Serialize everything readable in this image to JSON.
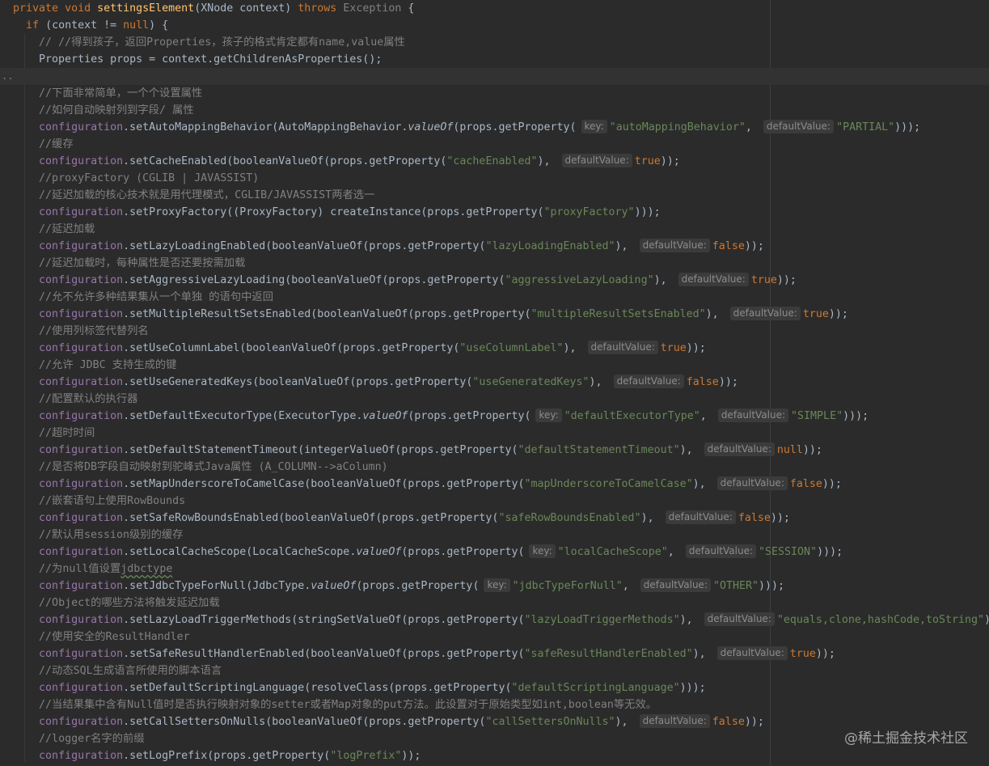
{
  "editor": {
    "lines": [
      {
        "segments": [
          [
            "k",
            "private "
          ],
          [
            "k",
            "void "
          ],
          [
            "fn",
            "settingsElement"
          ],
          [
            "n",
            "(XNode context) "
          ],
          [
            "k",
            "throws "
          ],
          [
            "gr",
            "Exception "
          ],
          [
            "n",
            "{"
          ]
        ]
      },
      {
        "segments": [
          [
            "n",
            "  "
          ],
          [
            "k",
            "if "
          ],
          [
            "n",
            "(context != "
          ],
          [
            "k",
            "null"
          ],
          [
            "n",
            ") {"
          ]
        ]
      },
      {
        "segments": [
          [
            "n",
            "    "
          ],
          [
            "c",
            "// //得到孩子，返回Properties，孩子的格式肯定都有name,value属性"
          ]
        ]
      },
      {
        "segments": [
          [
            "n",
            "    Properties props = context.getChildrenAsProperties();"
          ]
        ]
      },
      {
        "segments": [],
        "current": true
      },
      {
        "segments": [
          [
            "n",
            "    "
          ],
          [
            "c",
            "//下面非常简单，一个个设置属性"
          ]
        ]
      },
      {
        "segments": [
          [
            "n",
            "    "
          ],
          [
            "c",
            "//如何自动映射列到字段/ 属性"
          ]
        ]
      },
      {
        "segments": [
          [
            "n",
            "    "
          ],
          [
            "f",
            "configuration"
          ],
          [
            "n",
            ".setAutoMappingBehavior(AutoMappingBehavior."
          ],
          [
            "st",
            "valueOf"
          ],
          [
            "n",
            "(props.getProperty("
          ],
          [
            "h",
            "key:"
          ],
          [
            "s",
            "\"autoMappingBehavior\""
          ],
          [
            "n",
            ", "
          ],
          [
            "h",
            "defaultValue:"
          ],
          [
            "s",
            "\"PARTIAL\""
          ],
          [
            "n",
            ")));"
          ]
        ]
      },
      {
        "segments": [
          [
            "n",
            "    "
          ],
          [
            "c",
            "//缓存"
          ]
        ]
      },
      {
        "segments": [
          [
            "n",
            "    "
          ],
          [
            "f",
            "configuration"
          ],
          [
            "n",
            ".setCacheEnabled(booleanValueOf(props.getProperty("
          ],
          [
            "s",
            "\"cacheEnabled\""
          ],
          [
            "n",
            "), "
          ],
          [
            "h",
            "defaultValue:"
          ],
          [
            "k",
            "true"
          ],
          [
            "n",
            "));"
          ]
        ]
      },
      {
        "segments": [
          [
            "n",
            "    "
          ],
          [
            "c",
            "//proxyFactory (CGLIB | JAVASSIST)"
          ]
        ]
      },
      {
        "segments": [
          [
            "n",
            "    "
          ],
          [
            "c",
            "//延迟加载的核心技术就是用代理模式，CGLIB/JAVASSIST两者选一"
          ]
        ]
      },
      {
        "segments": [
          [
            "n",
            "    "
          ],
          [
            "f",
            "configuration"
          ],
          [
            "n",
            ".setProxyFactory((ProxyFactory) createInstance(props.getProperty("
          ],
          [
            "s",
            "\"proxyFactory\""
          ],
          [
            "n",
            ")));"
          ]
        ]
      },
      {
        "segments": [
          [
            "n",
            "    "
          ],
          [
            "c",
            "//延迟加载"
          ]
        ]
      },
      {
        "segments": [
          [
            "n",
            "    "
          ],
          [
            "f",
            "configuration"
          ],
          [
            "n",
            ".setLazyLoadingEnabled(booleanValueOf(props.getProperty("
          ],
          [
            "s",
            "\"lazyLoadingEnabled\""
          ],
          [
            "n",
            "), "
          ],
          [
            "h",
            "defaultValue:"
          ],
          [
            "k",
            "false"
          ],
          [
            "n",
            "));"
          ]
        ]
      },
      {
        "segments": [
          [
            "n",
            "    "
          ],
          [
            "c",
            "//延迟加载时，每种属性是否还要按需加载"
          ]
        ]
      },
      {
        "segments": [
          [
            "n",
            "    "
          ],
          [
            "f",
            "configuration"
          ],
          [
            "n",
            ".setAggressiveLazyLoading(booleanValueOf(props.getProperty("
          ],
          [
            "s",
            "\"aggressiveLazyLoading\""
          ],
          [
            "n",
            "), "
          ],
          [
            "h",
            "defaultValue:"
          ],
          [
            "k",
            "true"
          ],
          [
            "n",
            "));"
          ]
        ]
      },
      {
        "segments": [
          [
            "n",
            "    "
          ],
          [
            "c",
            "//允不允许多种结果集从一个单独 的语句中返回"
          ]
        ]
      },
      {
        "segments": [
          [
            "n",
            "    "
          ],
          [
            "f",
            "configuration"
          ],
          [
            "n",
            ".setMultipleResultSetsEnabled(booleanValueOf(props.getProperty("
          ],
          [
            "s",
            "\"multipleResultSetsEnabled\""
          ],
          [
            "n",
            "), "
          ],
          [
            "h",
            "defaultValue:"
          ],
          [
            "k",
            "true"
          ],
          [
            "n",
            "));"
          ]
        ]
      },
      {
        "segments": [
          [
            "n",
            "    "
          ],
          [
            "c",
            "//使用列标签代替列名"
          ]
        ]
      },
      {
        "segments": [
          [
            "n",
            "    "
          ],
          [
            "f",
            "configuration"
          ],
          [
            "n",
            ".setUseColumnLabel(booleanValueOf(props.getProperty("
          ],
          [
            "s",
            "\"useColumnLabel\""
          ],
          [
            "n",
            "), "
          ],
          [
            "h",
            "defaultValue:"
          ],
          [
            "k",
            "true"
          ],
          [
            "n",
            "));"
          ]
        ]
      },
      {
        "segments": [
          [
            "n",
            "    "
          ],
          [
            "c",
            "//允许 JDBC 支持生成的键"
          ]
        ]
      },
      {
        "segments": [
          [
            "n",
            "    "
          ],
          [
            "f",
            "configuration"
          ],
          [
            "n",
            ".setUseGeneratedKeys(booleanValueOf(props.getProperty("
          ],
          [
            "s",
            "\"useGeneratedKeys\""
          ],
          [
            "n",
            "), "
          ],
          [
            "h",
            "defaultValue:"
          ],
          [
            "k",
            "false"
          ],
          [
            "n",
            "));"
          ]
        ]
      },
      {
        "segments": [
          [
            "n",
            "    "
          ],
          [
            "c",
            "//配置默认的执行器"
          ]
        ]
      },
      {
        "segments": [
          [
            "n",
            "    "
          ],
          [
            "f",
            "configuration"
          ],
          [
            "n",
            ".setDefaultExecutorType(ExecutorType."
          ],
          [
            "st",
            "valueOf"
          ],
          [
            "n",
            "(props.getProperty("
          ],
          [
            "h",
            "key:"
          ],
          [
            "s",
            "\"defaultExecutorType\""
          ],
          [
            "n",
            ", "
          ],
          [
            "h",
            "defaultValue:"
          ],
          [
            "s",
            "\"SIMPLE\""
          ],
          [
            "n",
            ")));"
          ]
        ]
      },
      {
        "segments": [
          [
            "n",
            "    "
          ],
          [
            "c",
            "//超时时间"
          ]
        ]
      },
      {
        "segments": [
          [
            "n",
            "    "
          ],
          [
            "f",
            "configuration"
          ],
          [
            "n",
            ".setDefaultStatementTimeout(integerValueOf(props.getProperty("
          ],
          [
            "s",
            "\"defaultStatementTimeout\""
          ],
          [
            "n",
            "), "
          ],
          [
            "h",
            "defaultValue:"
          ],
          [
            "k",
            "null"
          ],
          [
            "n",
            "));"
          ]
        ]
      },
      {
        "segments": [
          [
            "n",
            "    "
          ],
          [
            "c",
            "//是否将DB字段自动映射到驼峰式Java属性 (A_COLUMN-->aColumn)"
          ]
        ]
      },
      {
        "segments": [
          [
            "n",
            "    "
          ],
          [
            "f",
            "configuration"
          ],
          [
            "n",
            ".setMapUnderscoreToCamelCase(booleanValueOf(props.getProperty("
          ],
          [
            "s",
            "\"mapUnderscoreToCamelCase\""
          ],
          [
            "n",
            "), "
          ],
          [
            "h",
            "defaultValue:"
          ],
          [
            "k",
            "false"
          ],
          [
            "n",
            "));"
          ]
        ]
      },
      {
        "segments": [
          [
            "n",
            "    "
          ],
          [
            "c",
            "//嵌套语句上使用RowBounds"
          ]
        ]
      },
      {
        "segments": [
          [
            "n",
            "    "
          ],
          [
            "f",
            "configuration"
          ],
          [
            "n",
            ".setSafeRowBoundsEnabled(booleanValueOf(props.getProperty("
          ],
          [
            "s",
            "\"safeRowBoundsEnabled\""
          ],
          [
            "n",
            "), "
          ],
          [
            "h",
            "defaultValue:"
          ],
          [
            "k",
            "false"
          ],
          [
            "n",
            "));"
          ]
        ]
      },
      {
        "segments": [
          [
            "n",
            "    "
          ],
          [
            "c",
            "//默认用session级别的缓存"
          ]
        ]
      },
      {
        "segments": [
          [
            "n",
            "    "
          ],
          [
            "f",
            "configuration"
          ],
          [
            "n",
            ".setLocalCacheScope(LocalCacheScope."
          ],
          [
            "st",
            "valueOf"
          ],
          [
            "n",
            "(props.getProperty("
          ],
          [
            "h",
            "key:"
          ],
          [
            "s",
            "\"localCacheScope\""
          ],
          [
            "n",
            ", "
          ],
          [
            "h",
            "defaultValue:"
          ],
          [
            "s",
            "\"SESSION\""
          ],
          [
            "n",
            ")));"
          ]
        ]
      },
      {
        "segments": [
          [
            "n",
            "    "
          ],
          [
            "c",
            "//为null值设置"
          ],
          [
            "cs",
            "jdbctype"
          ]
        ]
      },
      {
        "segments": [
          [
            "n",
            "    "
          ],
          [
            "f",
            "configuration"
          ],
          [
            "n",
            ".setJdbcTypeForNull(JdbcType."
          ],
          [
            "st",
            "valueOf"
          ],
          [
            "n",
            "(props.getProperty("
          ],
          [
            "h",
            "key:"
          ],
          [
            "s",
            "\"jdbcTypeForNull\""
          ],
          [
            "n",
            ", "
          ],
          [
            "h",
            "defaultValue:"
          ],
          [
            "s",
            "\"OTHER\""
          ],
          [
            "n",
            ")));"
          ]
        ]
      },
      {
        "segments": [
          [
            "n",
            "    "
          ],
          [
            "c",
            "//Object的哪些方法将触发延迟加载"
          ]
        ]
      },
      {
        "segments": [
          [
            "n",
            "    "
          ],
          [
            "f",
            "configuration"
          ],
          [
            "n",
            ".setLazyLoadTriggerMethods(stringSetValueOf(props.getProperty("
          ],
          [
            "s",
            "\"lazyLoadTriggerMethods\""
          ],
          [
            "n",
            "), "
          ],
          [
            "h",
            "defaultValue:"
          ],
          [
            "s",
            "\"equals,clone,hashCode,toString\""
          ],
          [
            "n",
            "));"
          ]
        ]
      },
      {
        "segments": [
          [
            "n",
            "    "
          ],
          [
            "c",
            "//使用安全的ResultHandler"
          ]
        ]
      },
      {
        "segments": [
          [
            "n",
            "    "
          ],
          [
            "f",
            "configuration"
          ],
          [
            "n",
            ".setSafeResultHandlerEnabled(booleanValueOf(props.getProperty("
          ],
          [
            "s",
            "\"safeResultHandlerEnabled\""
          ],
          [
            "n",
            "), "
          ],
          [
            "h",
            "defaultValue:"
          ],
          [
            "k",
            "true"
          ],
          [
            "n",
            "));"
          ]
        ]
      },
      {
        "segments": [
          [
            "n",
            "    "
          ],
          [
            "c",
            "//动态SQL生成语言所使用的脚本语言"
          ]
        ]
      },
      {
        "segments": [
          [
            "n",
            "    "
          ],
          [
            "f",
            "configuration"
          ],
          [
            "n",
            ".setDefaultScriptingLanguage(resolveClass(props.getProperty("
          ],
          [
            "s",
            "\"defaultScriptingLanguage\""
          ],
          [
            "n",
            ")));"
          ]
        ]
      },
      {
        "segments": [
          [
            "n",
            "    "
          ],
          [
            "c",
            "//当结果集中含有Null值时是否执行映射对象的setter或者Map对象的put方法。此设置对于原始类型如int,boolean等无效。"
          ]
        ]
      },
      {
        "segments": [
          [
            "n",
            "    "
          ],
          [
            "f",
            "configuration"
          ],
          [
            "n",
            ".setCallSettersOnNulls(booleanValueOf(props.getProperty("
          ],
          [
            "s",
            "\"callSettersOnNulls\""
          ],
          [
            "n",
            "), "
          ],
          [
            "h",
            "defaultValue:"
          ],
          [
            "k",
            "false"
          ],
          [
            "n",
            "));"
          ]
        ]
      },
      {
        "segments": [
          [
            "n",
            "    "
          ],
          [
            "c",
            "//logger名字的前缀"
          ]
        ]
      },
      {
        "segments": [
          [
            "n",
            "    "
          ],
          [
            "f",
            "configuration"
          ],
          [
            "n",
            ".setLogPrefix(props.getProperty("
          ],
          [
            "s",
            "\"logPrefix\""
          ],
          [
            "n",
            "));"
          ]
        ]
      }
    ]
  },
  "fold_marker": "..",
  "watermark": "@稀土掘金技术社区",
  "colors": {
    "background": "#2b2b2b",
    "keyword": "#cc7832",
    "method_decl": "#ffc66d",
    "field": "#9876aa",
    "string": "#6a8759",
    "comment": "#808080",
    "text": "#a9b7c6"
  }
}
